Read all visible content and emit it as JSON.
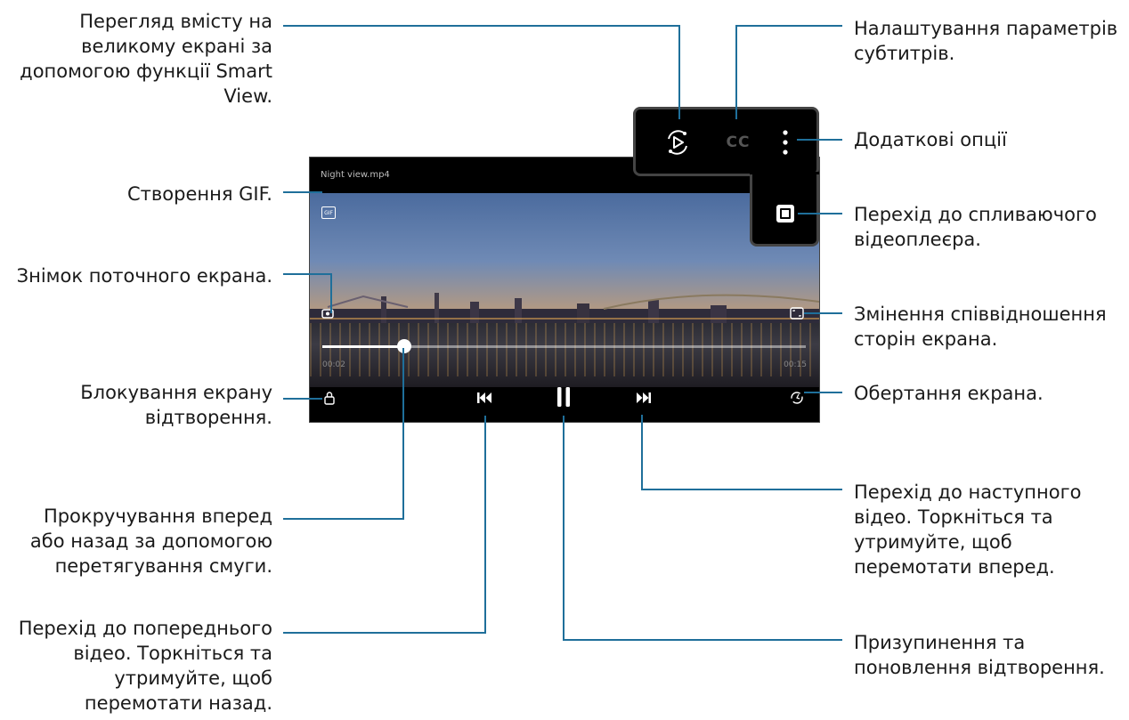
{
  "video": {
    "file_name": "Night view.mp4",
    "progress": 0.17,
    "time_elapsed": "00:02",
    "time_total": "00:15"
  },
  "buttons": {
    "gif": "GIF",
    "cc": "CC"
  },
  "annotations": {
    "smart_view": [
      "Перегляд вмісту на",
      "великому екрані за",
      "допомогою функції Smart",
      "View."
    ],
    "gif": [
      "Створення GIF."
    ],
    "capture": [
      "Знімок поточного екрана."
    ],
    "lock": [
      "Блокування екрану",
      "відтворення."
    ],
    "seek": [
      "Прокручування вперед",
      "або назад за допомогою",
      "перетягування смуги."
    ],
    "previous": [
      "Перехід до попереднього",
      "відео. Торкніться та",
      "утримуйте, щоб",
      "перемотати назад."
    ],
    "subtitles": [
      "Налаштування параметрів",
      "субтитрів."
    ],
    "more": [
      "Додаткові опції"
    ],
    "popup": [
      "Перехід до спливаючого",
      "відеоплеєра."
    ],
    "ratio": [
      "Змінення співвідношення",
      "сторін екрана."
    ],
    "rotate": [
      "Обертання екрана."
    ],
    "next": [
      "Перехід до наступного",
      "відео. Торкніться та",
      "утримуйте, щоб",
      "перемотати вперед."
    ],
    "pause": [
      "Призупинення та",
      "поновлення відтворення."
    ]
  },
  "colors": {
    "leader_line": "#1f6f9a",
    "control_frame": "#444444"
  }
}
